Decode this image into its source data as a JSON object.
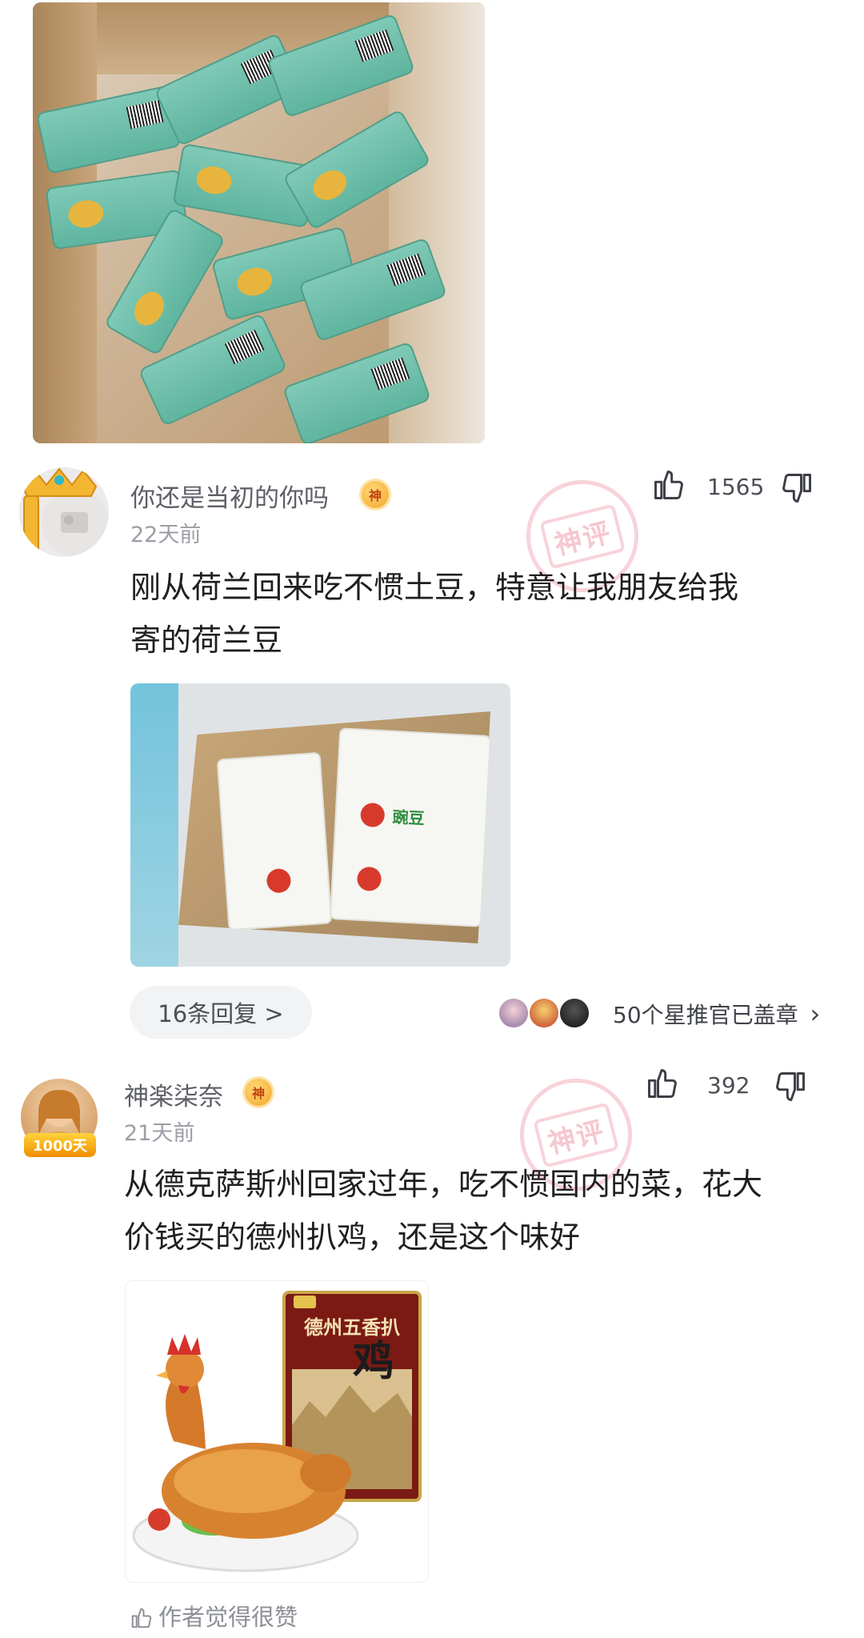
{
  "comments": [
    {
      "username": "你还是当初的你吗",
      "badge": "神",
      "time": "22天前",
      "likes": "1565",
      "text_line1": "刚从荷兰回来吃不惯土豆，特意让我朋友给我",
      "text_line2": "寄的荷兰豆",
      "stamp": "神评",
      "replies_label": "16条回复 >",
      "stars_label": "50个星推官已盖章",
      "stars_chevron": "›"
    },
    {
      "username": "神楽柒奈",
      "badge": "神",
      "time": "21天前",
      "likes": "392",
      "text_line1": "从德克萨斯州回家过年，吃不惯国内的菜，花大",
      "text_line2": "价钱买的德州扒鸡，还是这个味好",
      "stamp": "神评",
      "avatar_badge": "1000天",
      "author_like": "作者觉得很赞"
    }
  ],
  "photo_bot": {
    "package_title": "德州五香扒",
    "package_big": "鸡"
  },
  "photo_mid": {
    "packet_label": "豌豆"
  },
  "colors": {
    "stamp": "#ec8296",
    "badge": "#f2a62b",
    "muted": "#9b9ea5"
  },
  "icons": [
    "thumb-up-icon",
    "thumb-down-icon",
    "chevron-right-icon"
  ]
}
